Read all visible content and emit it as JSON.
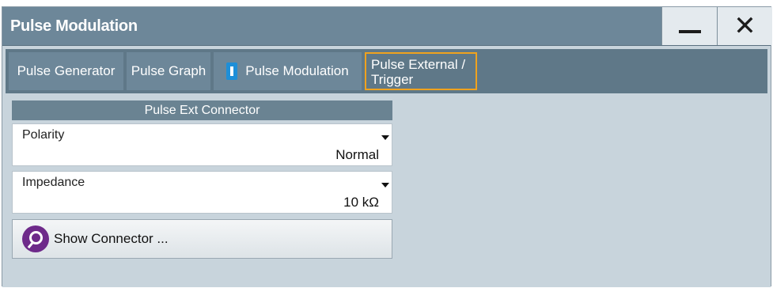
{
  "window": {
    "title": "Pulse Modulation",
    "minimize_icon": "minimize-icon",
    "close_icon": "close-icon"
  },
  "tabs": [
    {
      "label": "Pulse Generator"
    },
    {
      "label": "Pulse Graph"
    },
    {
      "label": "Pulse Modulation",
      "has_active_marker": true
    },
    {
      "label": "Pulse External / Trigger",
      "selected": true
    }
  ],
  "section": {
    "header": "Pulse Ext Connector"
  },
  "fields": {
    "polarity": {
      "label": "Polarity",
      "value": "Normal"
    },
    "impedance": {
      "label": "Impedance",
      "value": "10 kΩ"
    }
  },
  "show_connector": {
    "label": "Show Connector ...",
    "icon": "magnifier-icon"
  },
  "colors": {
    "title_bar": "#6d8799",
    "selected_tab_border": "#f0a21e",
    "active_marker": "#1e8fd8",
    "show_icon": "#6e2a8a"
  }
}
